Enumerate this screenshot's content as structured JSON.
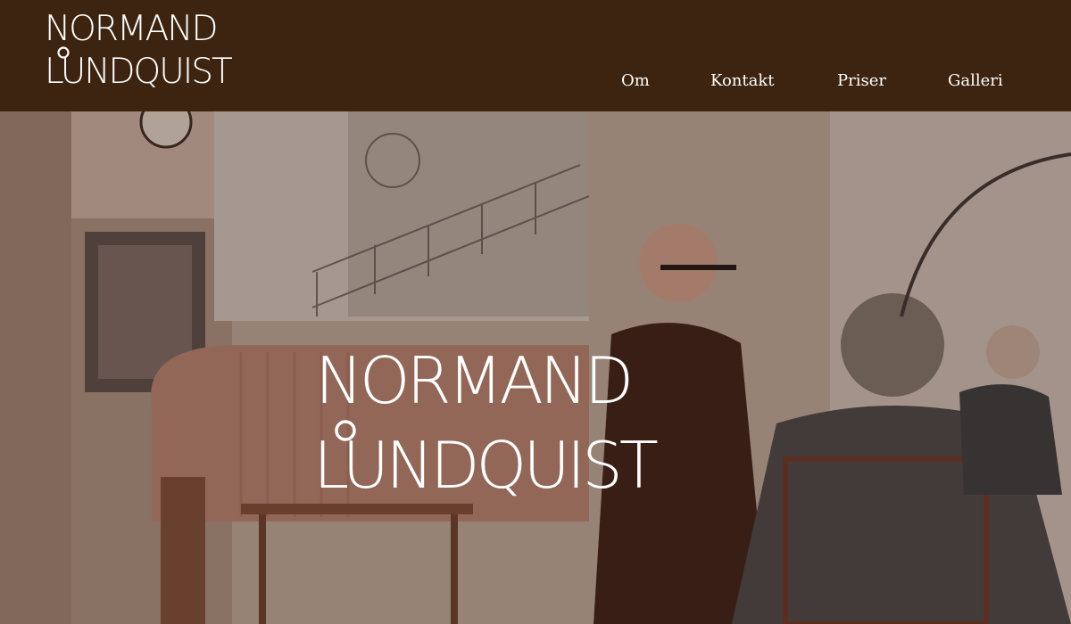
{
  "brand": {
    "line1": "NORMAND",
    "line2": "LUNDQUIST",
    "text_color": "#ffffff",
    "header_color": "#3d2410"
  },
  "nav": {
    "items": [
      {
        "label": "Om"
      },
      {
        "label": "Kontakt"
      },
      {
        "label": "Priser"
      },
      {
        "label": "Galleri"
      }
    ]
  },
  "hero": {
    "title_line1": "NORMAND",
    "title_line2": "LUNDQUIST"
  }
}
